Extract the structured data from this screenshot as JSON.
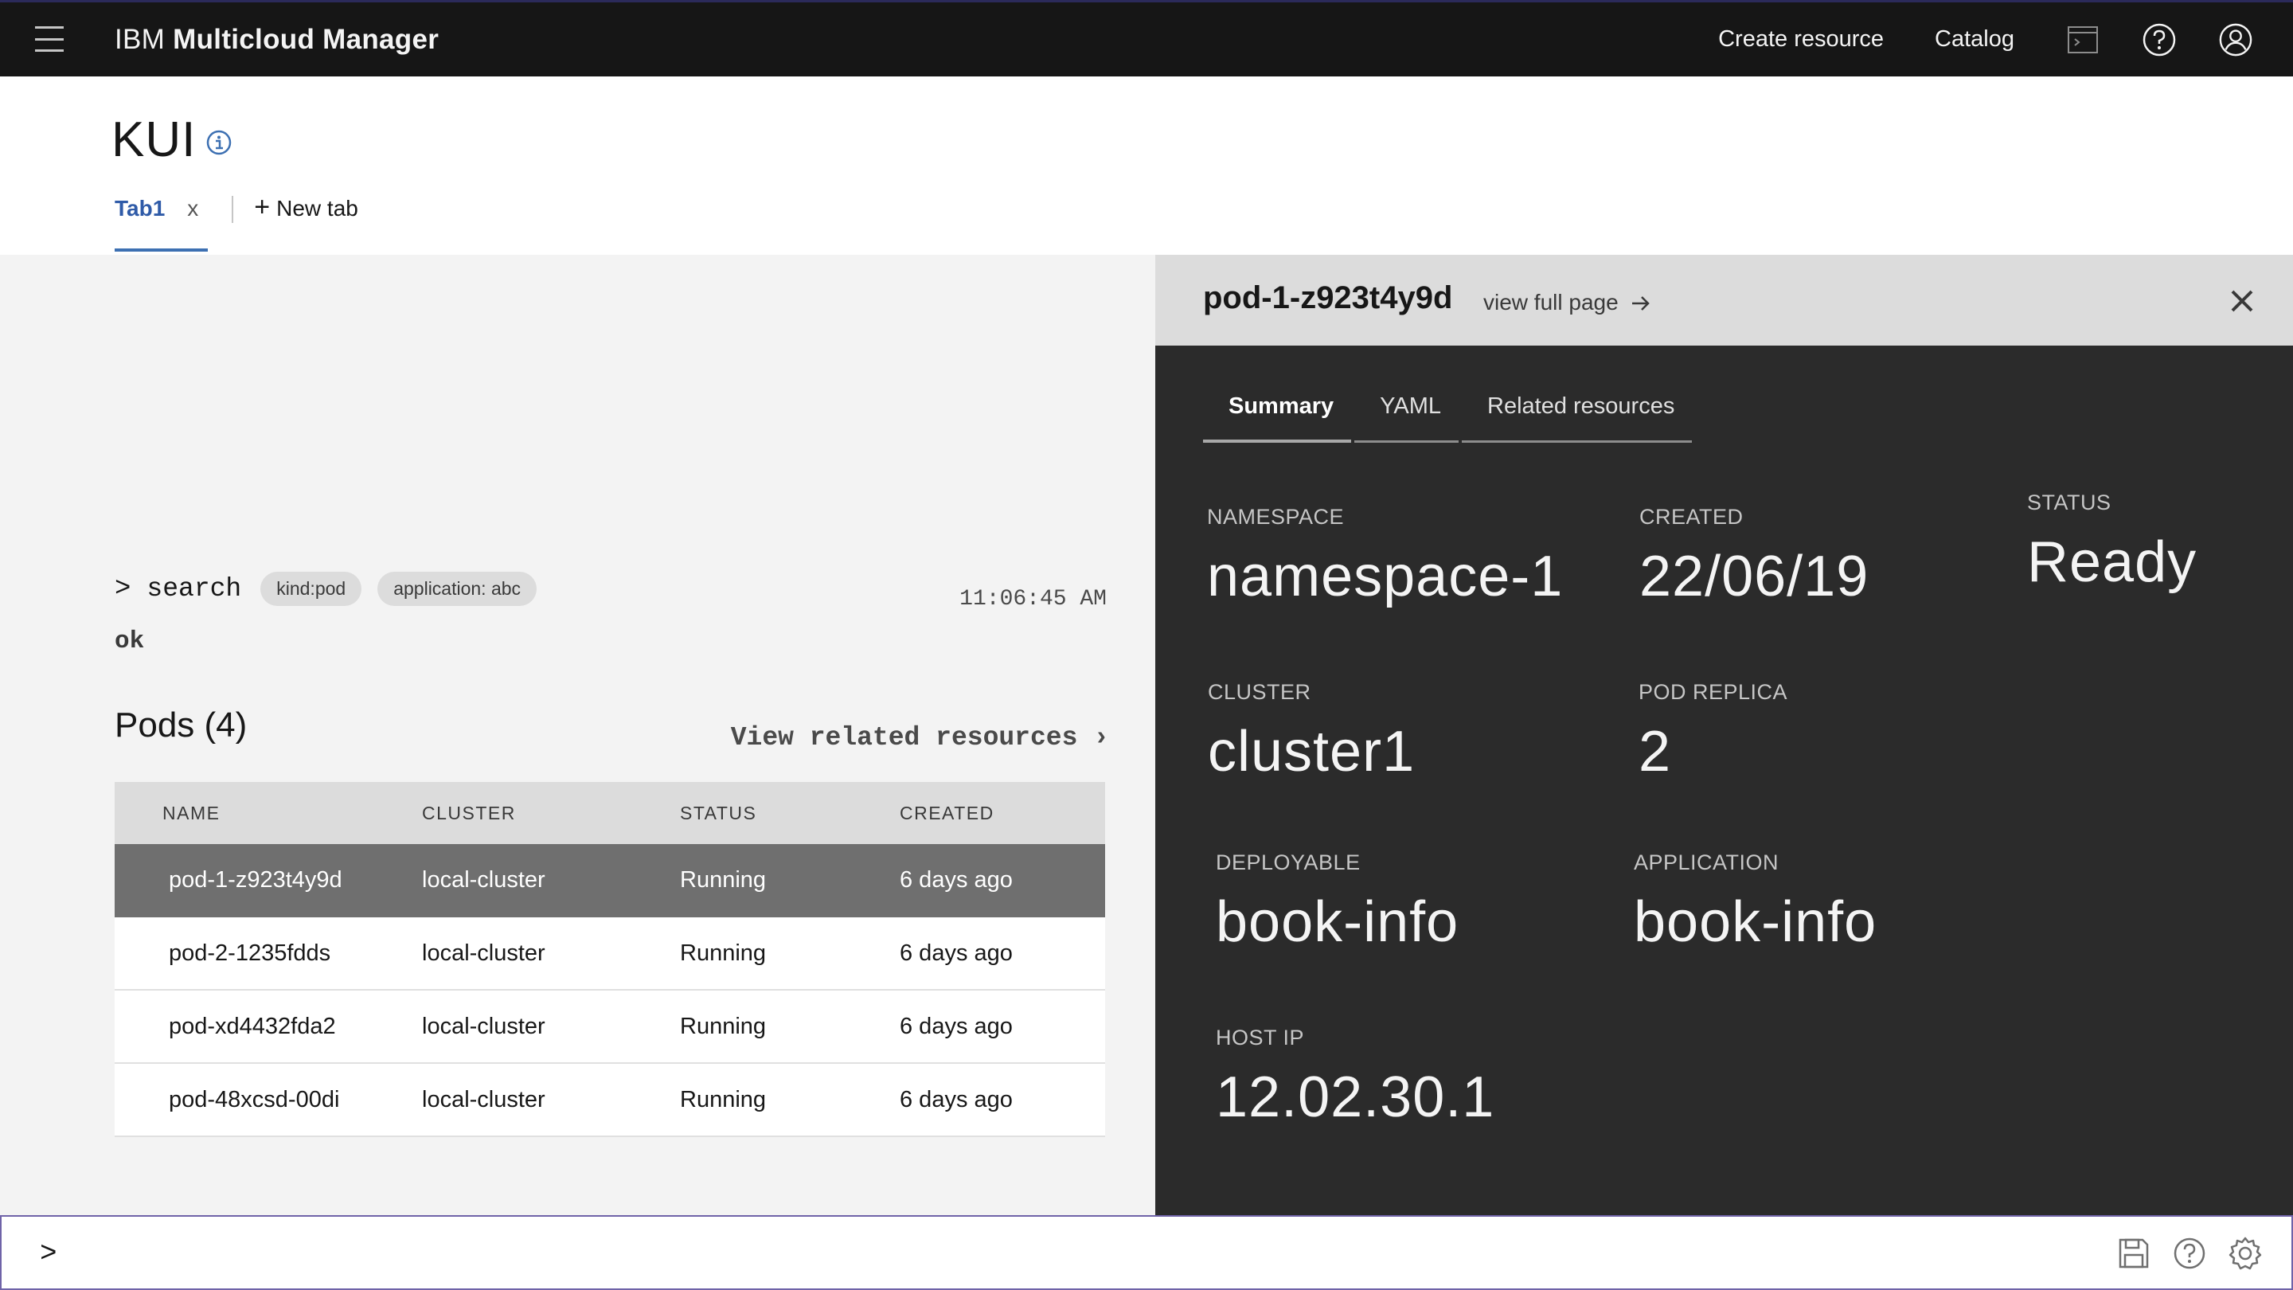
{
  "header": {
    "brand_prefix": "IBM",
    "brand_name": "Multicloud Manager",
    "create_resource": "Create resource",
    "catalog": "Catalog",
    "icons": [
      "menu-icon",
      "terminal-icon",
      "help-icon",
      "user-icon"
    ]
  },
  "page": {
    "title": "KUI",
    "tabs": [
      {
        "label": "Tab1",
        "close": "x"
      }
    ],
    "new_tab": "New tab"
  },
  "terminal": {
    "prompt": ">",
    "command": "search",
    "chips": [
      "kind:pod",
      "application: abc"
    ],
    "timestamp": "11:06:45 AM",
    "result": "ok",
    "table_title": "Pods (4)",
    "related_link": "View related resources ›",
    "columns": [
      "NAME",
      "CLUSTER",
      "STATUS",
      "CREATED"
    ],
    "rows": [
      {
        "name": "pod-1-z923t4y9d",
        "cluster": "local-cluster",
        "status": "Running",
        "created": "6 days ago"
      },
      {
        "name": "pod-2-1235fdds",
        "cluster": "local-cluster",
        "status": "Running",
        "created": "6 days ago"
      },
      {
        "name": "pod-xd4432fda2",
        "cluster": "local-cluster",
        "status": "Running",
        "created": "6 days ago"
      },
      {
        "name": "pod-48xcsd-00di",
        "cluster": "local-cluster",
        "status": "Running",
        "created": "6 days ago"
      }
    ]
  },
  "sidecar": {
    "title": "pod-1-z923t4y9d",
    "view_full_page": "view full page",
    "tabs": [
      "Summary",
      "YAML",
      "Related resources"
    ],
    "fields": {
      "namespace": {
        "label": "NAMESPACE",
        "value": "namespace-1"
      },
      "created": {
        "label": "CREATED",
        "value": "22/06/19"
      },
      "status": {
        "label": "STATUS",
        "value": "Ready"
      },
      "cluster": {
        "label": "CLUSTER",
        "value": "cluster1"
      },
      "pod_replica": {
        "label": "POD REPLICA",
        "value": "2"
      },
      "deployable": {
        "label": "DEPLOYABLE",
        "value": "book-info"
      },
      "application": {
        "label": "APPLICATION",
        "value": "book-info"
      },
      "host_ip": {
        "label": "HOST IP",
        "value": "12.02.30.1"
      }
    }
  },
  "command_bar": {
    "prompt": ">",
    "value": "",
    "icons": [
      "save-icon",
      "help-icon",
      "settings-icon"
    ]
  },
  "colors": {
    "header_bg": "#161616",
    "accent": "#3d70b2",
    "sidecar_bg": "#2b2b2b",
    "selected_row": "#6f6f6f"
  }
}
